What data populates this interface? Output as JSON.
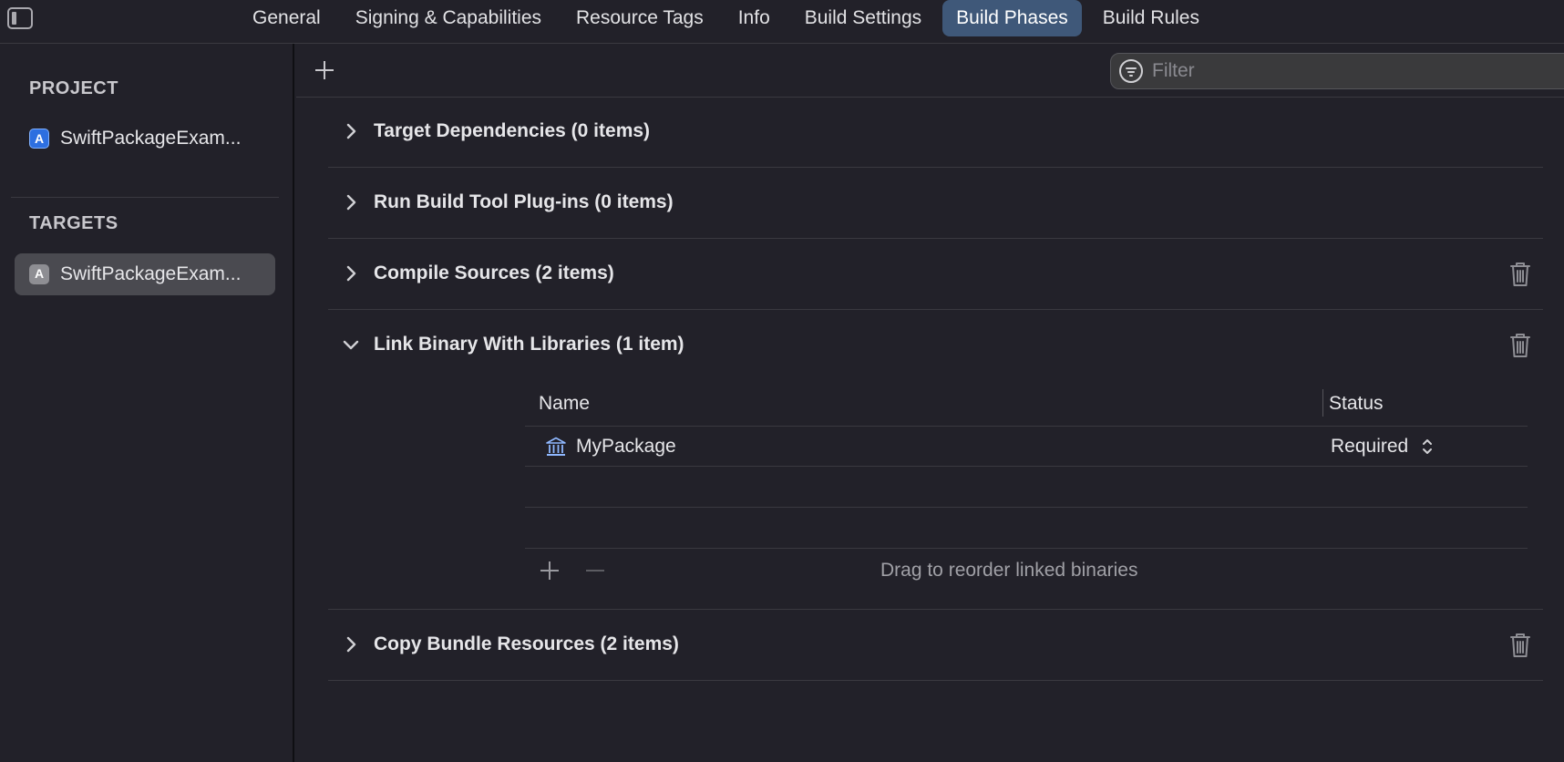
{
  "tabs": [
    {
      "label": "General",
      "active": false
    },
    {
      "label": "Signing & Capabilities",
      "active": false
    },
    {
      "label": "Resource Tags",
      "active": false
    },
    {
      "label": "Info",
      "active": false
    },
    {
      "label": "Build Settings",
      "active": false
    },
    {
      "label": "Build Phases",
      "active": true
    },
    {
      "label": "Build Rules",
      "active": false
    }
  ],
  "sidebar": {
    "project_header": "PROJECT",
    "project_item": "SwiftPackageExam...",
    "targets_header": "TARGETS",
    "target_item": "SwiftPackageExam..."
  },
  "toolbar": {
    "filter_placeholder": "Filter"
  },
  "phases": [
    {
      "title": "Target Dependencies (0 items)",
      "expanded": false,
      "deletable": false
    },
    {
      "title": "Run Build Tool Plug-ins (0 items)",
      "expanded": false,
      "deletable": false
    },
    {
      "title": "Compile Sources (2 items)",
      "expanded": false,
      "deletable": true
    },
    {
      "title": "Link Binary With Libraries (1 item)",
      "expanded": true,
      "deletable": true
    },
    {
      "title": "Copy Bundle Resources (2 items)",
      "expanded": false,
      "deletable": true
    }
  ],
  "link_table": {
    "col_name": "Name",
    "col_status": "Status",
    "rows": [
      {
        "name": "MyPackage",
        "status": "Required",
        "icon": "library-icon"
      }
    ],
    "hint": "Drag to reorder linked binaries"
  },
  "colors": {
    "background": "#222129",
    "active_tab": "#3f5879",
    "selected_row": "#4a4a50"
  }
}
